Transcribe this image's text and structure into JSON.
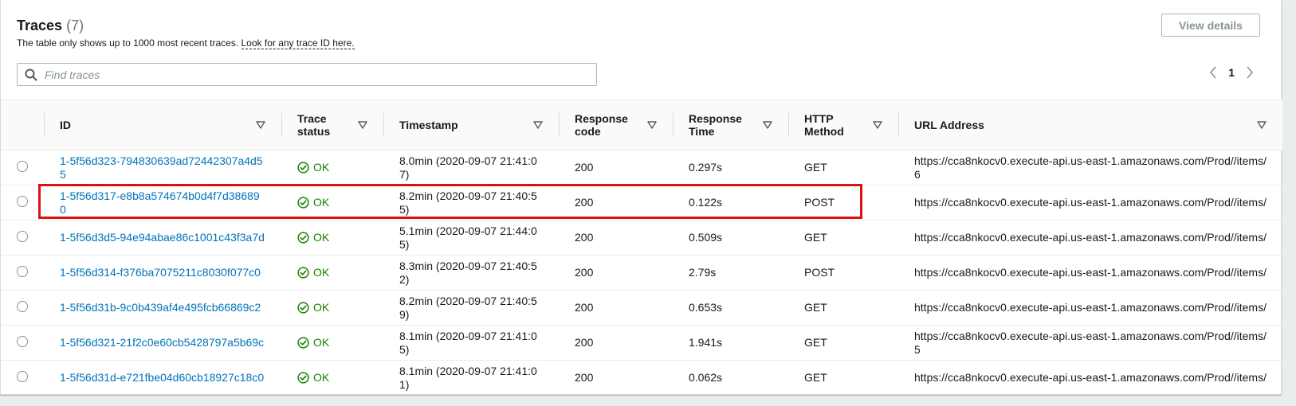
{
  "header": {
    "title": "Traces",
    "count": "(7)",
    "description": "The table only shows up to 1000 most recent traces.",
    "description_link": "Look for any trace ID here.",
    "view_details_label": "View details"
  },
  "search": {
    "placeholder": "Find traces",
    "value": ""
  },
  "pagination": {
    "current_page": "1"
  },
  "table": {
    "columns": [
      {
        "label": "ID"
      },
      {
        "label": "Trace status"
      },
      {
        "label": "Timestamp"
      },
      {
        "label": "Response code"
      },
      {
        "label": "Response Time"
      },
      {
        "label": "HTTP Method"
      },
      {
        "label": "URL Address"
      }
    ],
    "rows": [
      {
        "id": "1-5f56d323-794830639ad72442307a4d55",
        "status": "OK",
        "timestamp": "8.0min (2020-09-07 21:41:07)",
        "code": "200",
        "time": "0.297s",
        "method": "GET",
        "url": "https://cca8nkocv0.execute-api.us-east-1.amazonaws.com/Prod//items/6"
      },
      {
        "id": "1-5f56d317-e8b8a574674b0d4f7d386890",
        "status": "OK",
        "timestamp": "8.2min (2020-09-07 21:40:55)",
        "code": "200",
        "time": "0.122s",
        "method": "POST",
        "url": "https://cca8nkocv0.execute-api.us-east-1.amazonaws.com/Prod//items/"
      },
      {
        "id": "1-5f56d3d5-94e94abae86c1001c43f3a7d",
        "status": "OK",
        "timestamp": "5.1min (2020-09-07 21:44:05)",
        "code": "200",
        "time": "0.509s",
        "method": "GET",
        "url": "https://cca8nkocv0.execute-api.us-east-1.amazonaws.com/Prod//items/"
      },
      {
        "id": "1-5f56d314-f376ba7075211c8030f077c0",
        "status": "OK",
        "timestamp": "8.3min (2020-09-07 21:40:52)",
        "code": "200",
        "time": "2.79s",
        "method": "POST",
        "url": "https://cca8nkocv0.execute-api.us-east-1.amazonaws.com/Prod//items/"
      },
      {
        "id": "1-5f56d31b-9c0b439af4e495fcb66869c2",
        "status": "OK",
        "timestamp": "8.2min (2020-09-07 21:40:59)",
        "code": "200",
        "time": "0.653s",
        "method": "GET",
        "url": "https://cca8nkocv0.execute-api.us-east-1.amazonaws.com/Prod//items/"
      },
      {
        "id": "1-5f56d321-21f2c0e60cb5428797a5b69c",
        "status": "OK",
        "timestamp": "8.1min (2020-09-07 21:41:05)",
        "code": "200",
        "time": "1.941s",
        "method": "GET",
        "url": "https://cca8nkocv0.execute-api.us-east-1.amazonaws.com/Prod//items/5"
      },
      {
        "id": "1-5f56d31d-e721fbe04d60cb18927c18c0",
        "status": "OK",
        "timestamp": "8.1min (2020-09-07 21:41:01)",
        "code": "200",
        "time": "0.062s",
        "method": "GET",
        "url": "https://cca8nkocv0.execute-api.us-east-1.amazonaws.com/Prod//items/"
      }
    ]
  },
  "colors": {
    "link": "#0073bb",
    "success": "#1d8102",
    "highlight": "#e20f0f"
  }
}
